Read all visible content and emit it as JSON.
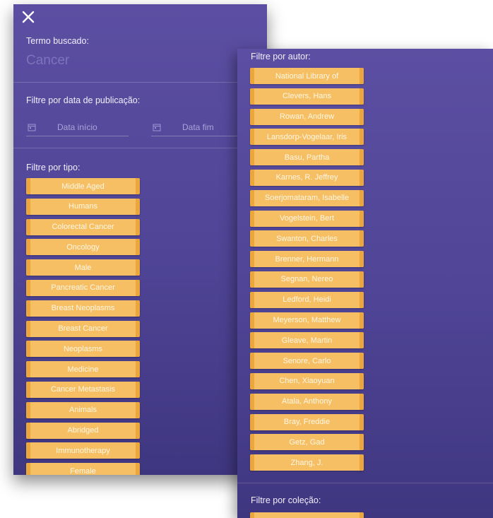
{
  "search": {
    "title": "Termo buscado:",
    "value": "Cancer"
  },
  "date_filter": {
    "title": "Filtre por data de publicação:",
    "start_placeholder": "Data início",
    "end_placeholder": "Data fim"
  },
  "type_filter": {
    "title": "Filtre por tipo:",
    "items": [
      "Middle Aged",
      "Humans",
      "Colorectal Cancer",
      "Oncology",
      "Male",
      "Pancreatic Cancer",
      "Breast Neoplasms",
      "Breast Cancer",
      "Neoplasms",
      "Medicine",
      "Cancer Metastasis",
      "Animals",
      "Abridged",
      "Immunotherapy",
      "Female"
    ]
  },
  "author_filter": {
    "title": "Filtre por autor:",
    "items": [
      "National Library of",
      "Clevers, Hans",
      "Rowan, Andrew",
      "Lansdorp-Vogelaar, Iris",
      "Basu, Partha",
      "Karnes, R. Jeffrey",
      "Soerjomataram, Isabelle",
      "Vogelstein, Bert",
      "Swanton, Charles",
      "Brenner, Hermann",
      "Segnan, Nereo",
      "Ledford, Heidi",
      "Meyerson, Matthew",
      "Gleave, Martin",
      "Senore, Carlo",
      "Chen, Xiaoyuan",
      "Atala, Anthony",
      "Bray, Freddie",
      "Getz, Gad",
      "Zhang, J."
    ]
  },
  "collection_filter": {
    "title": "Filtre por coleção:"
  },
  "colors": {
    "panel": "#5c4fa3",
    "chip": "#f6bf63",
    "chip_edge": "#eba63d"
  },
  "icons": {
    "close": "close-icon",
    "calendar": "calendar-icon"
  }
}
